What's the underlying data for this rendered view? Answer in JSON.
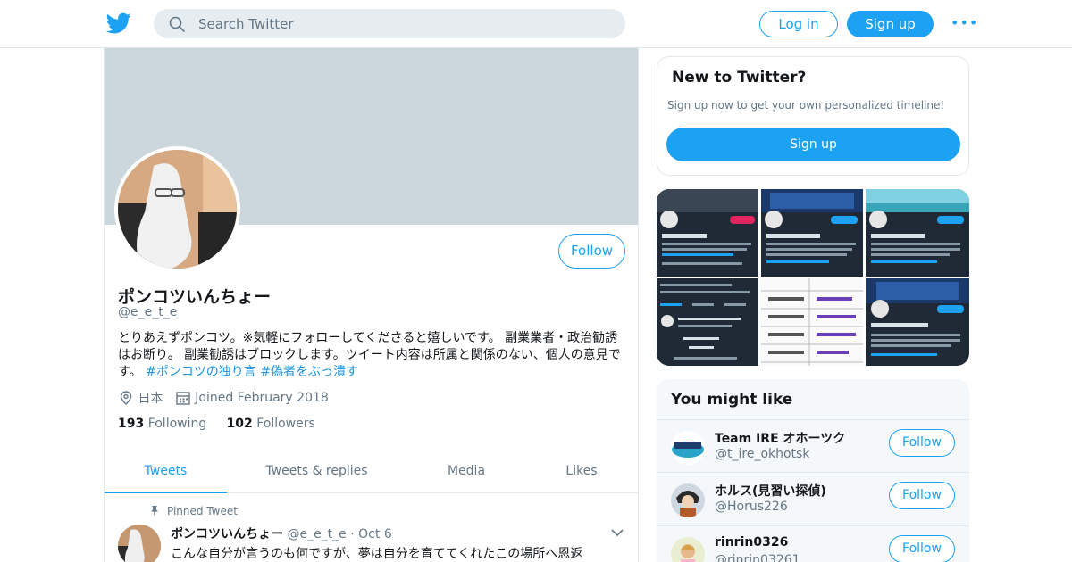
{
  "header": {
    "search_placeholder": "Search Twitter",
    "login_label": "Log in",
    "signup_label": "Sign up",
    "more_label": "•••"
  },
  "profile": {
    "display_name": "ポンコツいんちょー",
    "handle": "@e_e_t_e",
    "follow_label": "Follow",
    "bio_text": "とりあえずポンコツ。※気軽にフォローしてくださると嬉しいです。 副業業者・政治勧誘はお断り。 副業勧誘はブロックします。ツイート内容は所属と関係のない、個人の意見です。 ",
    "bio_tag_1": "#ポンコツの独り言",
    "bio_tag_2": "#偽者をぶっ潰す",
    "location": "日本",
    "joined": "Joined February 2018",
    "following_count": "193",
    "following_label": "Following",
    "followers_count": "102",
    "followers_label": "Followers"
  },
  "tabs": [
    {
      "label": "Tweets",
      "active": true
    },
    {
      "label": "Tweets & replies",
      "active": false
    },
    {
      "label": "Media",
      "active": false
    },
    {
      "label": "Likes",
      "active": false
    }
  ],
  "pinned_tweet": {
    "pin_label": "Pinned Tweet",
    "author_name": "ポンコツいんちょー",
    "author_handle": "@e_e_t_e",
    "separator": "·",
    "date": "Oct 6",
    "text": "こんな自分が言うのも何ですが、夢は自分を育ててくれたこの場所へ恩返"
  },
  "sidebar": {
    "new_title": "New to Twitter?",
    "new_desc": "Sign up now to get your own personalized timeline!",
    "new_signup": "Sign up",
    "might_like_title": "You might like",
    "suggestions": [
      {
        "name": "Team IRE オホーツク",
        "handle": "@t_ire_okhotsk",
        "follow": "Follow"
      },
      {
        "name": "ホルス(見習い探偵)",
        "handle": "@Horus226",
        "follow": "Follow"
      },
      {
        "name": "rinrin0326",
        "handle": "@rinrin03261",
        "follow": "Follow"
      }
    ]
  },
  "colors": {
    "accent": "#1da1f2",
    "banner": "#ccd6dd",
    "muted": "#657786"
  }
}
